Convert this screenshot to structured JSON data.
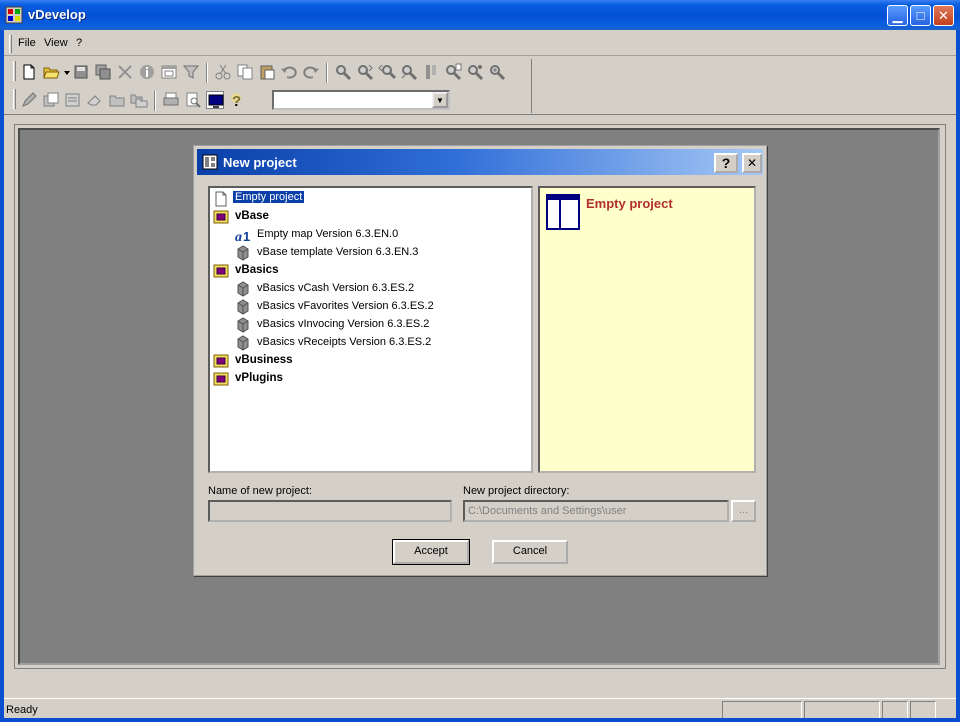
{
  "window": {
    "title": "vDevelop"
  },
  "window_controls": {
    "minimize": "▁",
    "maximize": "□",
    "close": "✕"
  },
  "menu": {
    "file": "File",
    "view": "View",
    "help": "?"
  },
  "toolbar": {
    "row1_icons": [
      "new-file-icon",
      "open-folder-icon",
      "dropdown-arrow-icon",
      "save-icon",
      "save-all-icon",
      "properties-icon",
      "info-icon",
      "window-icon",
      "filter-icon",
      "cut-icon",
      "copy-icon",
      "paste-icon",
      "undo-icon",
      "redo-icon",
      "find-icon",
      "find-next-icon",
      "find-prev-icon",
      "replace-icon",
      "bookmark-icon",
      "find-in-files-icon",
      "search-options-icon",
      "zoom-icon"
    ],
    "row2_icons": [
      "edit-icon",
      "duplicate-icon",
      "form-icon",
      "eraser-icon",
      "folder-icon",
      "folders-icon",
      "print-icon",
      "print-preview-icon",
      "monitor-icon",
      "help-icon"
    ],
    "combo_value": ""
  },
  "dialog": {
    "title": "New project",
    "help_button": "?",
    "close_button": "✕",
    "tree": [
      {
        "label": "Empty project",
        "type": "file",
        "selected": true
      },
      {
        "label": "vBase",
        "type": "group"
      },
      {
        "label": "Empty map Version 6.3.EN.0",
        "type": "map"
      },
      {
        "label": "vBase template Version 6.3.EN.3",
        "type": "template"
      },
      {
        "label": "vBasics",
        "type": "group"
      },
      {
        "label": "vBasics vCash Version 6.3.ES.2",
        "type": "template"
      },
      {
        "label": "vBasics vFavorites Version 6.3.ES.2",
        "type": "template"
      },
      {
        "label": "vBasics vInvocing Version 6.3.ES.2",
        "type": "template"
      },
      {
        "label": "vBasics vReceipts Version 6.3.ES.2",
        "type": "template"
      },
      {
        "label": "vBusiness",
        "type": "group"
      },
      {
        "label": "vPlugins",
        "type": "group"
      }
    ],
    "preview_title": "Empty project",
    "name_label": "Name of new project:",
    "name_value": "",
    "dir_label": "New project directory:",
    "dir_value": "C:\\Documents and Settings\\user",
    "browse_label": "...",
    "accept_label": "Accept",
    "cancel_label": "Cancel"
  },
  "status": {
    "text": "Ready"
  },
  "colors": {
    "title_blue": "#0450d5",
    "selection": "#0a3fa8",
    "preview_bg": "#ffffcc",
    "preview_title": "#b03030"
  }
}
